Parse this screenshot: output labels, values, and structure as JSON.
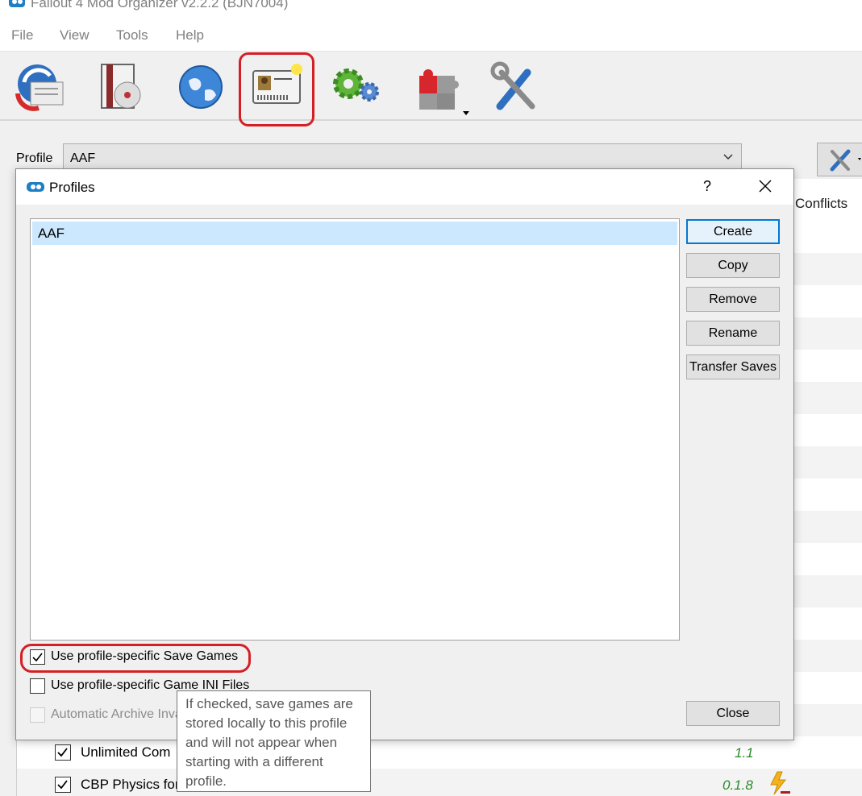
{
  "window": {
    "title": "Fallout 4 Mod Organizer v2.2.2 (BJN7004)"
  },
  "menu": [
    "File",
    "View",
    "Tools",
    "Help"
  ],
  "toolbar": {
    "items": [
      {
        "id": "instances",
        "icon": "change-game-icon"
      },
      {
        "id": "install-mod",
        "icon": "install-mod-icon"
      },
      {
        "id": "nexus",
        "icon": "globe-icon"
      },
      {
        "id": "profiles",
        "icon": "profile-id-card-icon"
      },
      {
        "id": "executables",
        "icon": "gears-icon"
      },
      {
        "id": "tools",
        "icon": "puzzle-icon"
      },
      {
        "id": "settings",
        "icon": "wrench-screwdriver-icon"
      }
    ]
  },
  "profile_bar": {
    "label": "Profile",
    "selected": "AAF"
  },
  "modlist": {
    "conflicts_header": "Conflicts",
    "rows": [
      {
        "name": "Unlimited Com",
        "version": "1.1",
        "checked": true
      },
      {
        "name": "CBP Physics for",
        "version": "0.1.8",
        "checked": true
      }
    ]
  },
  "dialog": {
    "title": "Profiles",
    "help": "?",
    "profiles": [
      "AAF"
    ],
    "buttons": {
      "create": "Create",
      "copy": "Copy",
      "remove": "Remove",
      "rename": "Rename",
      "transfer": "Transfer Saves",
      "close": "Close"
    },
    "options": [
      {
        "label": "Use profile-specific Save Games",
        "checked": true,
        "enabled": true
      },
      {
        "label": "Use profile-specific Game INI Files",
        "checked": false,
        "enabled": true
      },
      {
        "label": "Automatic Archive Invalidation",
        "checked": false,
        "enabled": false
      }
    ],
    "tooltip": [
      "If checked, save games are",
      "stored locally to this profile",
      "and will not appear when",
      "starting with a different",
      "profile."
    ]
  },
  "colors": {
    "highlight_red": "#d51f26",
    "selection_blue": "#cce8ff",
    "default_button_border": "#0078d7",
    "version_green": "#2a8a2a"
  }
}
